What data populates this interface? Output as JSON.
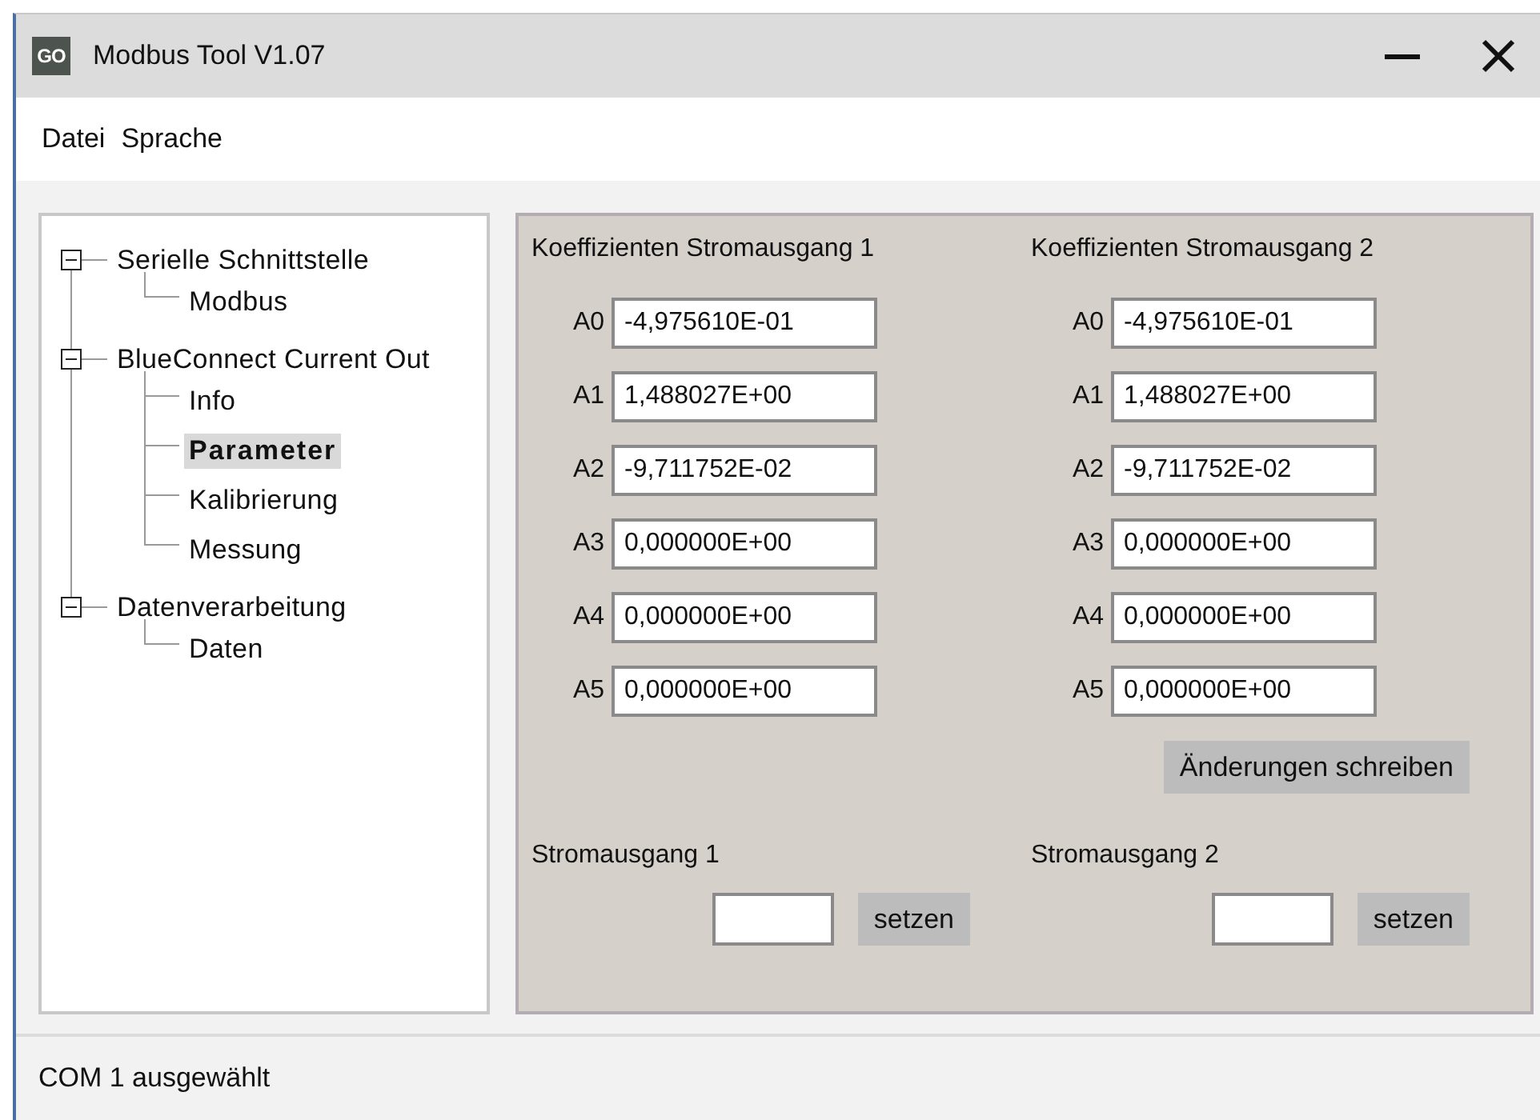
{
  "window": {
    "title": "Modbus Tool V1.07",
    "logo_text": "GO"
  },
  "menu": [
    "Datei",
    "Sprache"
  ],
  "tree": [
    {
      "label": "Serielle Schnittstelle",
      "expanded": true,
      "selected": false,
      "children": [
        {
          "label": "Modbus",
          "selected": false
        }
      ]
    },
    {
      "label": "BlueConnect Current Out",
      "expanded": true,
      "selected": false,
      "children": [
        {
          "label": "Info",
          "selected": false
        },
        {
          "label": "Parameter",
          "selected": true
        },
        {
          "label": "Kalibrierung",
          "selected": false
        },
        {
          "label": "Messung",
          "selected": false
        }
      ]
    },
    {
      "label": "Datenverarbeitung",
      "expanded": true,
      "selected": false,
      "children": [
        {
          "label": "Daten",
          "selected": false
        }
      ]
    }
  ],
  "coefficients": [
    {
      "title": "Koeffizienten Stromausgang 1",
      "rows": [
        {
          "label": "A0",
          "value": "-4,975610E-01"
        },
        {
          "label": "A1",
          "value": "1,488027E+00"
        },
        {
          "label": "A2",
          "value": "-9,711752E-02"
        },
        {
          "label": "A3",
          "value": "0,000000E+00"
        },
        {
          "label": "A4",
          "value": "0,000000E+00"
        },
        {
          "label": "A5",
          "value": "0,000000E+00"
        }
      ]
    },
    {
      "title": "Koeffizienten Stromausgang 2",
      "rows": [
        {
          "label": "A0",
          "value": "-4,975610E-01"
        },
        {
          "label": "A1",
          "value": "1,488027E+00"
        },
        {
          "label": "A2",
          "value": "-9,711752E-02"
        },
        {
          "label": "A3",
          "value": "0,000000E+00"
        },
        {
          "label": "A4",
          "value": "0,000000E+00"
        },
        {
          "label": "A5",
          "value": "0,000000E+00"
        }
      ]
    }
  ],
  "write_button": "Änderungen schreiben",
  "outputs": [
    {
      "label": "Stromausgang 1",
      "button": "setzen"
    },
    {
      "label": "Stromausgang 2",
      "button": "setzen"
    }
  ],
  "status_bar": "COM 1 ausgewählt"
}
